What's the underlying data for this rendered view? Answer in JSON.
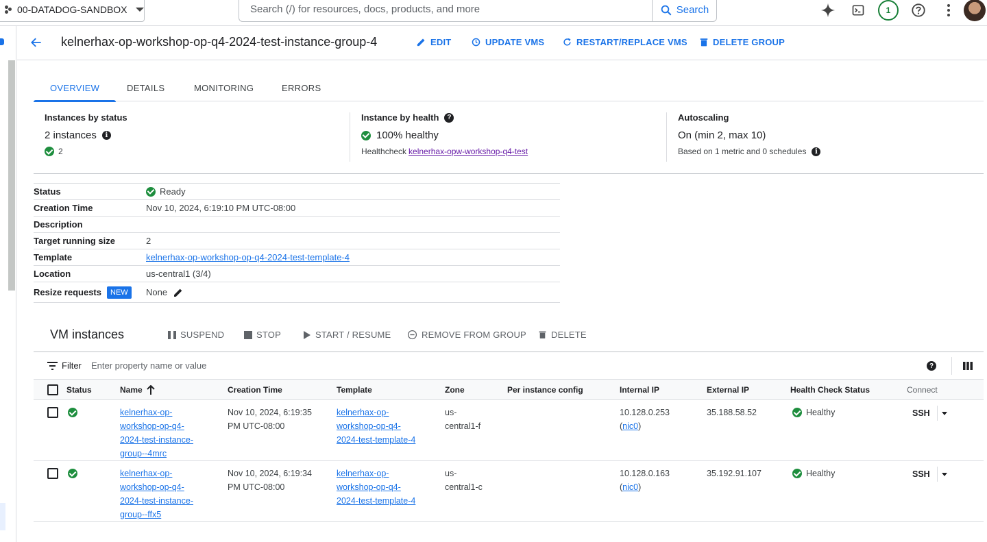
{
  "topbar": {
    "project": "00-DATADOG-SANDBOX",
    "search_placeholder": "Search (/) for resources, docs, products, and more",
    "search_button": "Search",
    "notification_count": "1"
  },
  "header": {
    "title": "kelnerhax-op-workshop-op-q4-2024-test-instance-group-4",
    "actions": [
      "EDIT",
      "UPDATE VMS",
      "RESTART/REPLACE VMS",
      "DELETE GROUP"
    ]
  },
  "tabs": [
    "OVERVIEW",
    "DETAILS",
    "MONITORING",
    "ERRORS"
  ],
  "summary": {
    "status": {
      "title": "Instances by status",
      "count": "2 instances",
      "healthy_count": "2"
    },
    "health": {
      "title": "Instance by health",
      "value": "100% healthy",
      "healthcheck_label": "Healthcheck",
      "healthcheck_link": "kelnerhax-opw-workshop-q4-test"
    },
    "autoscaling": {
      "title": "Autoscaling",
      "value": "On (min 2, max 10)",
      "basis": "Based on 1 metric and 0 schedules"
    }
  },
  "details": {
    "status_label": "Status",
    "status_value": "Ready",
    "creation_label": "Creation Time",
    "creation_value": "Nov 10, 2024, 6:19:10 PM UTC-08:00",
    "description_label": "Description",
    "target_label": "Target running size",
    "target_value": "2",
    "template_label": "Template",
    "template_value": "kelnerhax-op-workshop-op-q4-2024-test-template-4",
    "location_label": "Location",
    "location_value": "us-central1 (3/4)",
    "resize_label": "Resize requests",
    "resize_badge": "NEW",
    "resize_value": "None"
  },
  "vm": {
    "title": "VM instances",
    "actions": [
      "SUSPEND",
      "STOP",
      "START / RESUME",
      "REMOVE FROM GROUP",
      "DELETE"
    ],
    "filter_label": "Filter",
    "filter_placeholder": "Enter property name or value",
    "columns": [
      "Status",
      "Name",
      "Creation Time",
      "Template",
      "Zone",
      "Per instance config",
      "Internal IP",
      "External IP",
      "Health Check Status",
      "Connect"
    ],
    "rows": [
      {
        "name_lines": [
          "kelnerhax-op-",
          "workshop-op-q4-",
          "2024-test-instance-",
          "group--4mrc"
        ],
        "created_lines": [
          "Nov 10, 2024, 6:19:35",
          "PM UTC-08:00"
        ],
        "template_lines": [
          "kelnerhax-op-",
          "workshop-op-q4-",
          "2024-test-template-4"
        ],
        "zone_lines": [
          "us-",
          "central1-f"
        ],
        "internal_ip": "10.128.0.253",
        "nic": "nic0",
        "external_ip": "35.188.58.52",
        "health": "Healthy",
        "connect": "SSH"
      },
      {
        "name_lines": [
          "kelnerhax-op-",
          "workshop-op-q4-",
          "2024-test-instance-",
          "group--ffx5"
        ],
        "created_lines": [
          "Nov 10, 2024, 6:19:34",
          "PM UTC-08:00"
        ],
        "template_lines": [
          "kelnerhax-op-",
          "workshop-op-q4-",
          "2024-test-template-4"
        ],
        "zone_lines": [
          "us-",
          "central1-c"
        ],
        "internal_ip": "10.128.0.163",
        "nic": "nic0",
        "external_ip": "35.192.91.107",
        "health": "Healthy",
        "connect": "SSH"
      }
    ]
  }
}
